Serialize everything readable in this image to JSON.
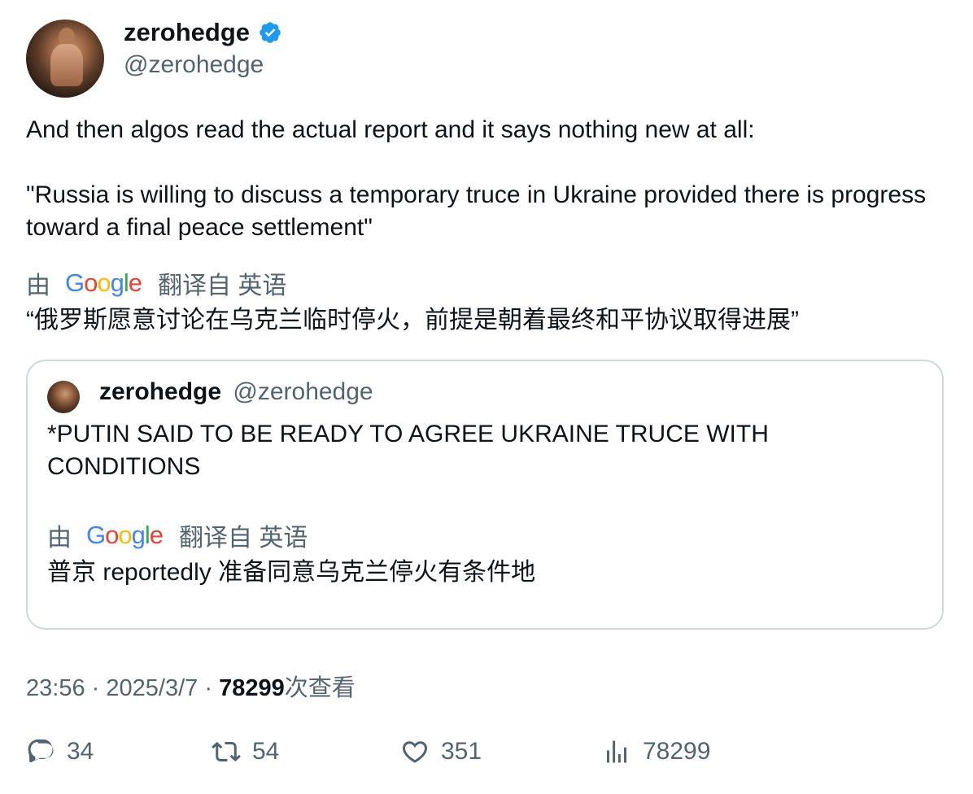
{
  "author": {
    "display_name": "zerohedge",
    "handle": "@zerohedge",
    "verified": true,
    "verified_color": "#1d9bf0"
  },
  "tweet": {
    "text": "And then algos read the actual report and it says nothing new at all:\n\n\"Russia is willing to discuss a temporary truce in Ukraine provided there is progress toward a final peace settlement\"",
    "translation_by": "由",
    "translation_from": "翻译自 英语",
    "translation": "“俄罗斯愿意讨论在乌克兰临时停火，前提是朝着最终和平协议取得进展”"
  },
  "quoted_tweet": {
    "display_name": "zerohedge",
    "handle": "@zerohedge",
    "text": "*PUTIN SAID TO BE READY TO AGREE UKRAINE TRUCE WITH CONDITIONS",
    "translation_by": "由",
    "translation_from": "翻译自 英语",
    "translation": "普京 reportedly 准备同意乌克兰停火有条件地"
  },
  "meta": {
    "time": "23:56",
    "separator": "·",
    "date": "2025/3/7",
    "views_count": "78299",
    "views_label": "次查看"
  },
  "actions": {
    "replies": "34",
    "retweets": "54",
    "likes": "351",
    "views": "78299"
  },
  "icons": [
    "reply-icon",
    "retweet-icon",
    "like-icon",
    "views-icon",
    "verified-badge-icon",
    "google-logo"
  ],
  "colors": {
    "text_primary": "#0f1419",
    "text_secondary": "#536471",
    "border": "#cfd9de",
    "verified": "#1d9bf0",
    "google_blue": "#4285f4",
    "google_red": "#ea4335",
    "google_yellow": "#fbbc05",
    "google_green": "#34a853"
  }
}
